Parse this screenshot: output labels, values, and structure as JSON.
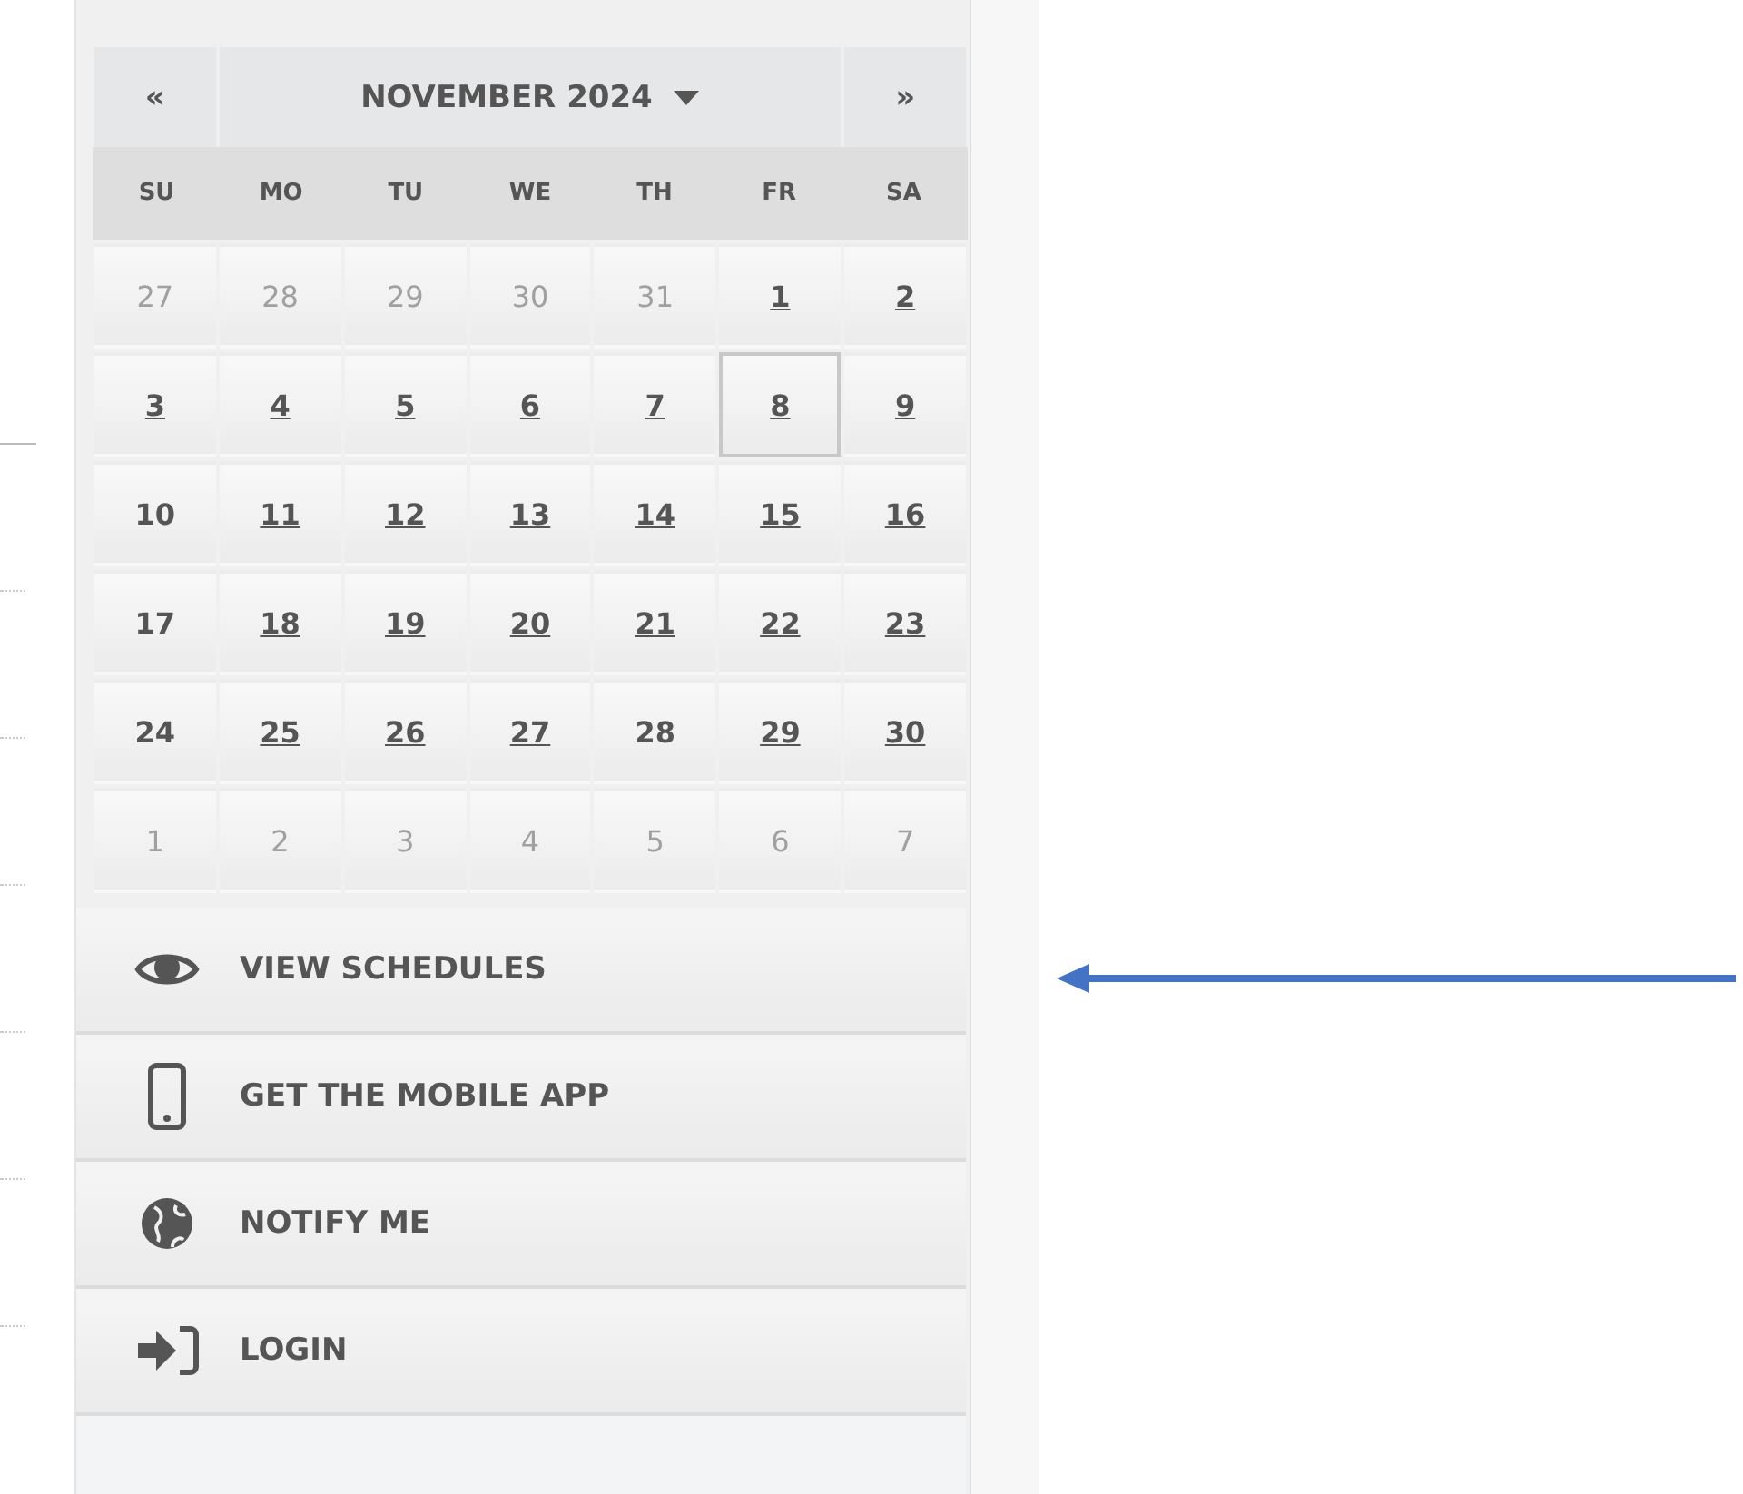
{
  "calendar": {
    "prev": "«",
    "title": "NOVEMBER 2024",
    "next": "»",
    "weekdays": [
      "SU",
      "MO",
      "TU",
      "WE",
      "TH",
      "FR",
      "SA"
    ],
    "days": [
      {
        "day": "27",
        "kind": "other",
        "selected": false
      },
      {
        "day": "28",
        "kind": "other",
        "selected": false
      },
      {
        "day": "29",
        "kind": "other",
        "selected": false
      },
      {
        "day": "30",
        "kind": "other",
        "selected": false
      },
      {
        "day": "31",
        "kind": "other",
        "selected": false
      },
      {
        "day": "1",
        "kind": "link",
        "selected": false
      },
      {
        "day": "2",
        "kind": "link",
        "selected": false
      },
      {
        "day": "3",
        "kind": "link",
        "selected": false
      },
      {
        "day": "4",
        "kind": "link",
        "selected": false
      },
      {
        "day": "5",
        "kind": "link",
        "selected": false
      },
      {
        "day": "6",
        "kind": "link",
        "selected": false
      },
      {
        "day": "7",
        "kind": "link",
        "selected": false
      },
      {
        "day": "8",
        "kind": "link",
        "selected": true
      },
      {
        "day": "9",
        "kind": "link",
        "selected": false
      },
      {
        "day": "10",
        "kind": "plain",
        "selected": false
      },
      {
        "day": "11",
        "kind": "link",
        "selected": false
      },
      {
        "day": "12",
        "kind": "link",
        "selected": false
      },
      {
        "day": "13",
        "kind": "link",
        "selected": false
      },
      {
        "day": "14",
        "kind": "link",
        "selected": false
      },
      {
        "day": "15",
        "kind": "link",
        "selected": false
      },
      {
        "day": "16",
        "kind": "link",
        "selected": false
      },
      {
        "day": "17",
        "kind": "plain",
        "selected": false
      },
      {
        "day": "18",
        "kind": "link",
        "selected": false
      },
      {
        "day": "19",
        "kind": "link",
        "selected": false
      },
      {
        "day": "20",
        "kind": "link",
        "selected": false
      },
      {
        "day": "21",
        "kind": "link",
        "selected": false
      },
      {
        "day": "22",
        "kind": "link",
        "selected": false
      },
      {
        "day": "23",
        "kind": "link",
        "selected": false
      },
      {
        "day": "24",
        "kind": "plain",
        "selected": false
      },
      {
        "day": "25",
        "kind": "link",
        "selected": false
      },
      {
        "day": "26",
        "kind": "link",
        "selected": false
      },
      {
        "day": "27",
        "kind": "link",
        "selected": false
      },
      {
        "day": "28",
        "kind": "plain",
        "selected": false
      },
      {
        "day": "29",
        "kind": "link",
        "selected": false
      },
      {
        "day": "30",
        "kind": "link",
        "selected": false
      },
      {
        "day": "1",
        "kind": "other",
        "selected": false
      },
      {
        "day": "2",
        "kind": "other",
        "selected": false
      },
      {
        "day": "3",
        "kind": "other",
        "selected": false
      },
      {
        "day": "4",
        "kind": "other",
        "selected": false
      },
      {
        "day": "5",
        "kind": "other",
        "selected": false
      },
      {
        "day": "6",
        "kind": "other",
        "selected": false
      },
      {
        "day": "7",
        "kind": "other",
        "selected": false
      }
    ]
  },
  "menu": [
    {
      "kind": "eye",
      "label": "VIEW SCHEDULES"
    },
    {
      "kind": "phone",
      "label": "GET THE MOBILE APP"
    },
    {
      "kind": "globe",
      "label": "NOTIFY ME"
    },
    {
      "kind": "login",
      "label": "LOGIN"
    }
  ]
}
